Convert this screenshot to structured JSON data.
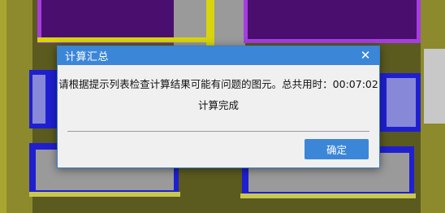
{
  "dialog": {
    "title": "计算汇总",
    "close_glyph": "✕",
    "message_line1": "请根据提示列表检查计算结果可能有问题的图元。总共用时：00:07:02",
    "message_line2": "计算完成",
    "ok_label": "确定"
  },
  "colors": {
    "titlebar": "#3c86d8",
    "button": "#3c86d8",
    "dialog_bg": "#f0f0f0"
  }
}
